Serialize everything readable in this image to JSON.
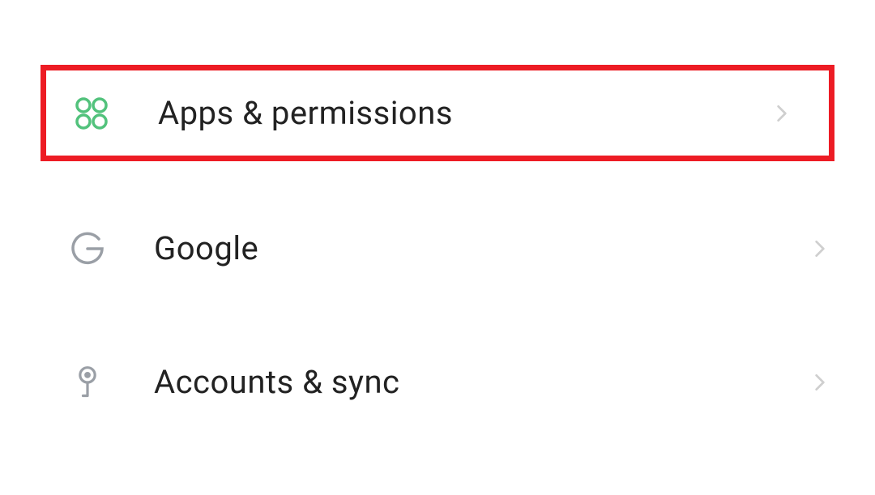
{
  "settings": {
    "items": [
      {
        "label": "Apps & permissions",
        "highlight_color": "#ed1c24",
        "icon_color": "#52c27c"
      },
      {
        "label": "Google",
        "icon_color": "#9a9fa6"
      },
      {
        "label": "Accounts & sync",
        "icon_color": "#9a9fa6"
      }
    ]
  }
}
